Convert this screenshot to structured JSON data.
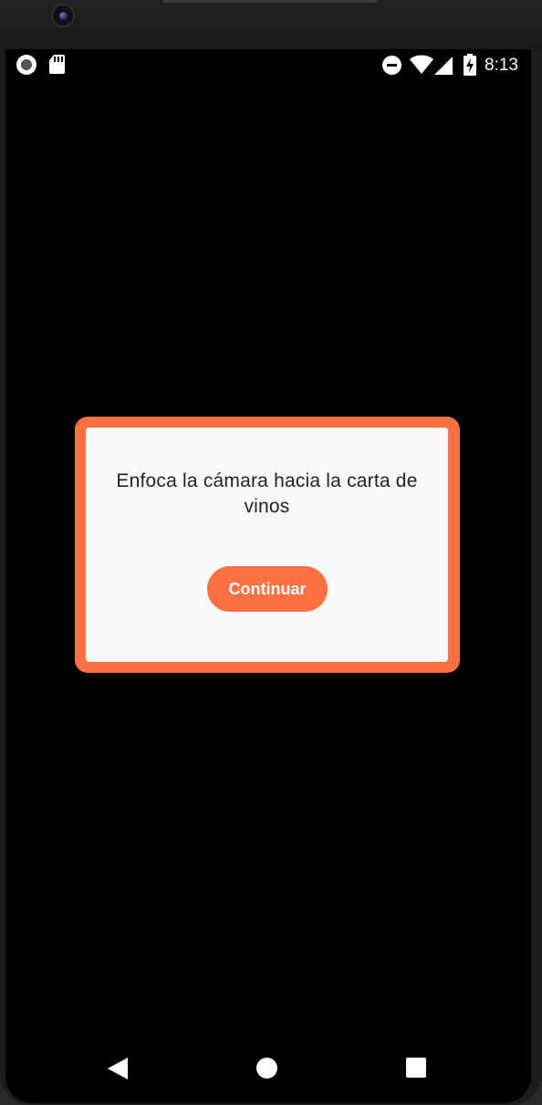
{
  "status_bar": {
    "time": "8:13",
    "icons": [
      "screen-record-icon",
      "sd-card-icon",
      "do-not-disturb-icon",
      "wifi-icon",
      "cellular-signal-icon",
      "battery-charging-icon"
    ]
  },
  "dialog": {
    "message": "Enfoca la cámara hacia la carta de vinos",
    "continue_label": "Continuar"
  },
  "nav_bar": {
    "icons": [
      "back-icon",
      "home-icon",
      "recents-icon"
    ]
  },
  "colors": {
    "accent": "#ff7043",
    "dialog_background": "#fafafa",
    "screen_background": "#000000"
  }
}
